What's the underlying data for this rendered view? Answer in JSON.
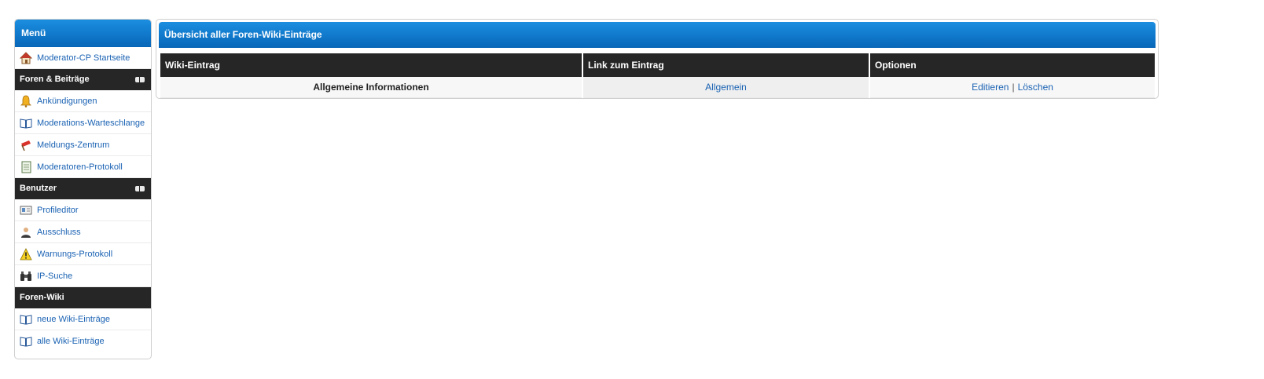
{
  "sidebar": {
    "title": "Menü",
    "home": {
      "label": "Moderator-CP Startseite",
      "icon": "house-icon"
    },
    "sections": [
      {
        "title": "Foren & Beiträge",
        "collapsible": true,
        "items": [
          {
            "label": "Ankündigungen",
            "icon": "bell-icon"
          },
          {
            "label": "Moderations-Warteschlange",
            "icon": "book-icon"
          },
          {
            "label": "Meldungs-Zentrum",
            "icon": "flag-icon"
          },
          {
            "label": "Moderatoren-Protokoll",
            "icon": "notepad-icon"
          }
        ]
      },
      {
        "title": "Benutzer",
        "collapsible": true,
        "items": [
          {
            "label": "Profileditor",
            "icon": "id-card-icon"
          },
          {
            "label": "Ausschluss",
            "icon": "person-icon"
          },
          {
            "label": "Warnungs-Protokoll",
            "icon": "warning-icon"
          },
          {
            "label": "IP-Suche",
            "icon": "binoculars-icon"
          }
        ]
      },
      {
        "title": "Foren-Wiki",
        "collapsible": false,
        "items": [
          {
            "label": "neue Wiki-Einträge",
            "icon": "book-icon"
          },
          {
            "label": "alle Wiki-Einträge",
            "icon": "book-icon"
          }
        ]
      }
    ]
  },
  "main": {
    "title": "Übersicht aller Foren-Wiki-Einträge",
    "columns": [
      "Wiki-Eintrag",
      "Link zum Eintrag",
      "Optionen"
    ],
    "rows": [
      {
        "entry": "Allgemeine Informationen",
        "link": "Allgemein",
        "edit": "Editieren",
        "separator": "|",
        "delete": "Löschen"
      }
    ]
  },
  "colors": {
    "header_blue": "#0a72c6",
    "section_dark": "#262626",
    "link_blue": "#1a62b3"
  }
}
